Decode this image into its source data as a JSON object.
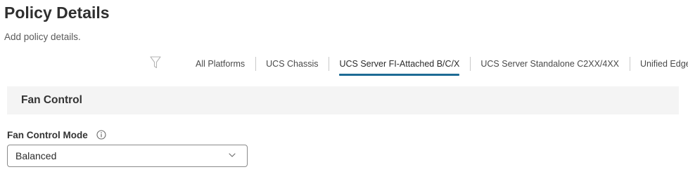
{
  "header": {
    "title": "Policy Details",
    "subtitle": "Add policy details."
  },
  "platform_filter": {
    "icon": "filter-icon",
    "tabs": [
      {
        "label": "All Platforms",
        "active": false
      },
      {
        "label": "UCS Chassis",
        "active": false
      },
      {
        "label": "UCS Server FI-Attached B/C/X",
        "active": true
      },
      {
        "label": "UCS Server Standalone C2XX/4XX",
        "active": false
      },
      {
        "label": "Unified Edge",
        "active": false
      }
    ],
    "active_color": "#1d6b95"
  },
  "section": {
    "title": "Fan Control"
  },
  "field": {
    "label": "Fan Control Mode",
    "info_icon": "info-icon",
    "value": "Balanced",
    "dropdown_icon": "chevron-down-icon"
  }
}
